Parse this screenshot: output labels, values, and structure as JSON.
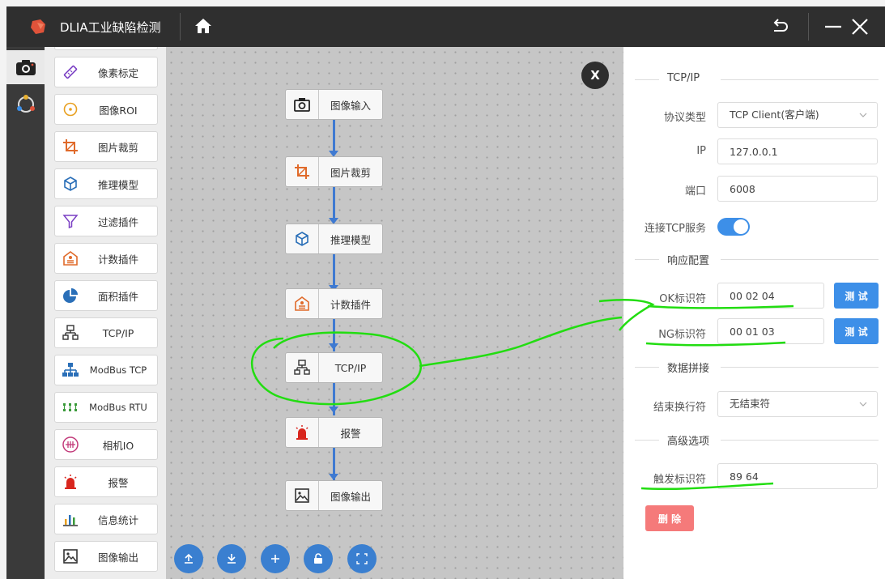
{
  "app": {
    "title": "DLIA工业缺陷检测"
  },
  "plugins": [
    {
      "label": "像素标定",
      "icon": "ruler-icon"
    },
    {
      "label": "图像ROI",
      "icon": "roi-target-icon"
    },
    {
      "label": "图片裁剪",
      "icon": "crop-icon"
    },
    {
      "label": "推理模型",
      "icon": "cube-icon"
    },
    {
      "label": "过滤插件",
      "icon": "filter-icon"
    },
    {
      "label": "计数插件",
      "icon": "counter-house-icon"
    },
    {
      "label": "面积插件",
      "icon": "pie-chart-icon"
    },
    {
      "label": "TCP/IP",
      "icon": "network-icon"
    },
    {
      "label": "ModBus TCP",
      "icon": "hierarchy-icon"
    },
    {
      "label": "ModBus RTU",
      "icon": "modbus-rtu-icon"
    },
    {
      "label": "相机IO",
      "icon": "camera-io-icon"
    },
    {
      "label": "报警",
      "icon": "alarm-icon"
    },
    {
      "label": "信息统计",
      "icon": "bar-chart-icon"
    },
    {
      "label": "图像输出",
      "icon": "image-icon"
    }
  ],
  "flow": {
    "nodes": [
      {
        "label": "图像输入",
        "icon": "camera-icon"
      },
      {
        "label": "图片裁剪",
        "icon": "crop-icon"
      },
      {
        "label": "推理模型",
        "icon": "cube-icon"
      },
      {
        "label": "计数插件",
        "icon": "counter-house-icon"
      },
      {
        "label": "TCP/IP",
        "icon": "network-icon"
      },
      {
        "label": "报警",
        "icon": "alarm-icon"
      },
      {
        "label": "图像输出",
        "icon": "image-icon"
      }
    ],
    "close_label": "X",
    "toolbar": [
      "upload-icon",
      "download-icon",
      "plus-icon",
      "lock-icon",
      "fullscreen-icon"
    ]
  },
  "config": {
    "section_tcp": "TCP/IP",
    "protocol_label": "协议类型",
    "protocol_value": "TCP Client(客户端)",
    "ip_label": "IP",
    "ip_value": "127.0.0.1",
    "port_label": "端口",
    "port_value": "6008",
    "connect_label": "连接TCP服务",
    "connect_on": true,
    "section_response": "响应配置",
    "ok_label": "OK标识符",
    "ok_value": "00 02 04",
    "ng_label": "NG标识符",
    "ng_value": "00 01 03",
    "test_label": "测 试",
    "section_data": "数据拼接",
    "endline_label": "结束换行符",
    "endline_value": "无结束符",
    "section_advanced": "高级选项",
    "trigger_label": "触发标识符",
    "trigger_value": "89 64",
    "delete_label": "删 除"
  },
  "colors": {
    "accent": "#3d8fe8",
    "danger": "#f57a7a",
    "annotation": "#22dd11",
    "titlebar": "#2f2f2f"
  }
}
